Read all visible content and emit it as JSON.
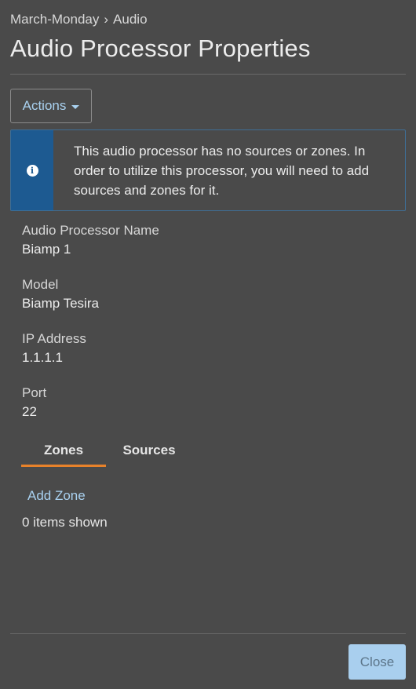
{
  "breadcrumb": {
    "parent": "March-Monday",
    "separator": "›",
    "current": "Audio"
  },
  "page_title": "Audio Processor Properties",
  "actions_button": {
    "label": "Actions",
    "icon": "caret-down-icon"
  },
  "alert": {
    "icon": "info-icon",
    "icon_glyph": "i",
    "message": "This audio processor has no sources or zones. In order to utilize this processor, you will need to add sources and zones for it."
  },
  "fields": [
    {
      "label": "Audio Processor Name",
      "value": "Biamp 1"
    },
    {
      "label": "Model",
      "value": "Biamp Tesira"
    },
    {
      "label": "IP Address",
      "value": "1.1.1.1"
    },
    {
      "label": "Port",
      "value": "22"
    }
  ],
  "tabs": [
    {
      "label": "Zones",
      "active": true
    },
    {
      "label": "Sources",
      "active": false
    }
  ],
  "add_zone_link": "Add Zone",
  "items_count_text": "0 items shown",
  "close_button": "Close",
  "colors": {
    "background": "#4a4a4a",
    "accent_link": "#a9d1f0",
    "active_tab_underline": "#e8822a",
    "alert_icon_bg": "#1d5a91",
    "close_button_bg": "#a9cfee"
  }
}
